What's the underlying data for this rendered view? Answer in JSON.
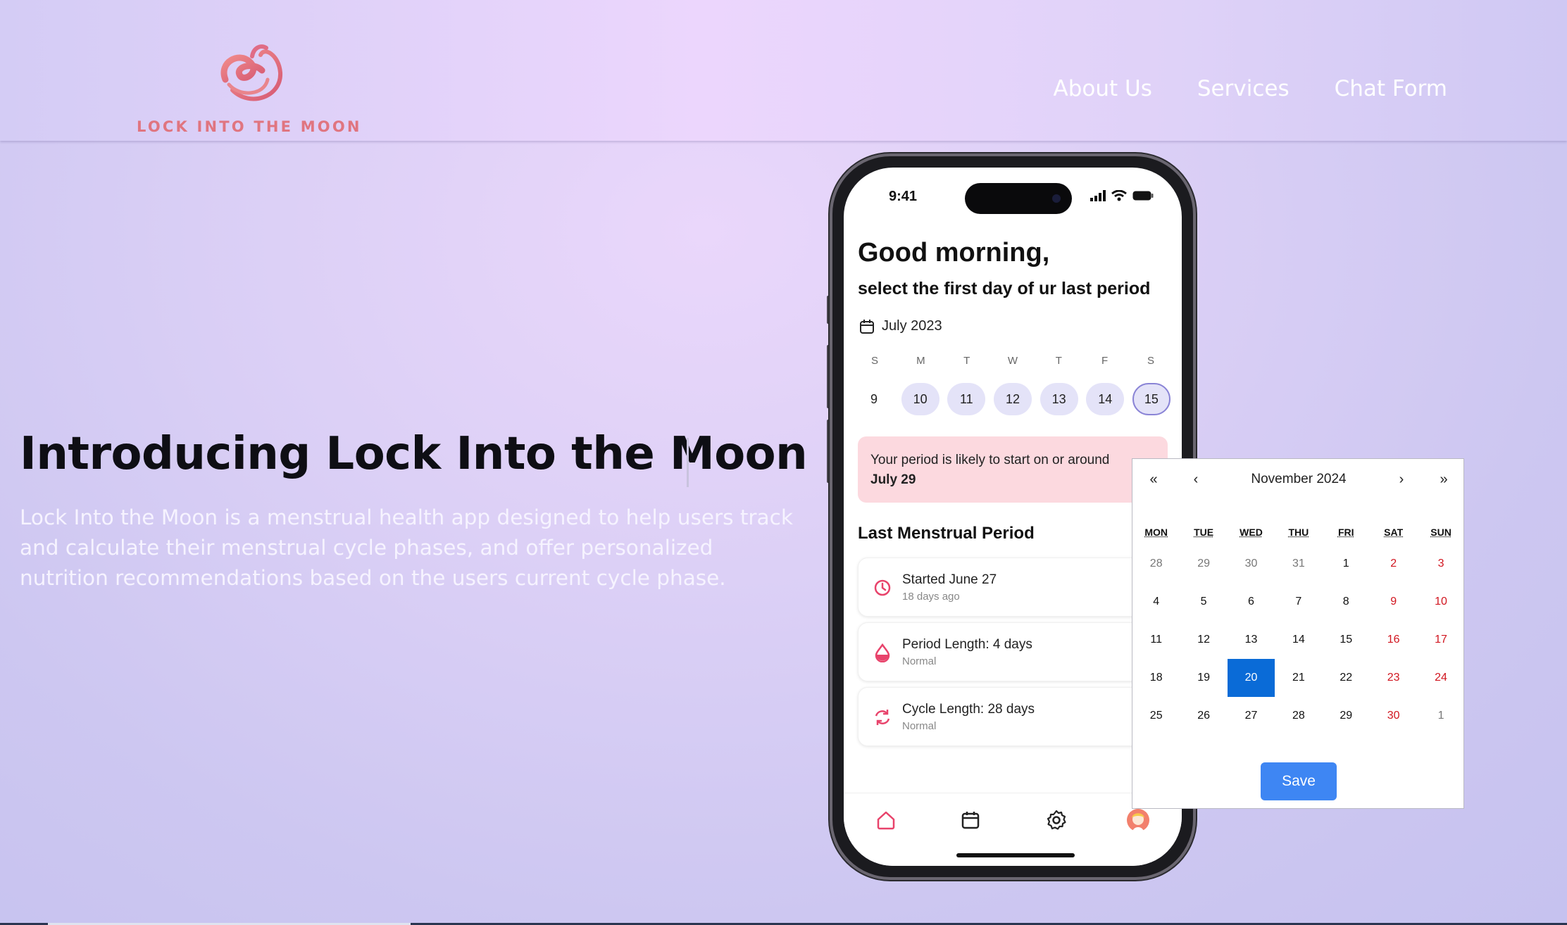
{
  "brand": {
    "name": "LOCK INTO THE MOON"
  },
  "nav": [
    {
      "label": "About Us"
    },
    {
      "label": "Services"
    },
    {
      "label": "Chat Form"
    }
  ],
  "hero": {
    "title": "Introducing Lock Into the Moon",
    "description": "Lock Into the Moon is a menstrual health app designed to help users track and calculate their menstrual cycle phases, and offer personalized nutrition recommendations based on the users current cycle phase."
  },
  "phone": {
    "time": "9:41",
    "greeting": "Good morning,",
    "subtitle": "select the first day of ur last period",
    "month": "July 2023",
    "weekdays": [
      "S",
      "M",
      "T",
      "W",
      "T",
      "F",
      "S"
    ],
    "days": [
      "9",
      "10",
      "11",
      "12",
      "13",
      "14",
      "15"
    ],
    "alert_text": "Your period is likely to start on or around",
    "alert_date": "July 29",
    "section_title": "Last Menstrual Period",
    "cards": [
      {
        "title": "Started June 27",
        "sub": "18 days ago",
        "icon": "clock-icon"
      },
      {
        "title": "Period Length: 4 days",
        "sub": "Normal",
        "icon": "drop-icon"
      },
      {
        "title": "Cycle Length: 28 days",
        "sub": "Normal",
        "icon": "cycle-icon"
      }
    ],
    "tabs": [
      "home-icon",
      "calendar-icon",
      "settings-icon",
      "avatar"
    ]
  },
  "picker": {
    "prev_year": "«",
    "prev_month": "‹",
    "next_month": "›",
    "next_year": "»",
    "title": "November 2024",
    "weekdays": [
      "MON",
      "TUE",
      "WED",
      "THU",
      "FRI",
      "SAT",
      "SUN"
    ],
    "weeks": [
      [
        "28",
        "29",
        "30",
        "31",
        "1",
        "2",
        "3"
      ],
      [
        "4",
        "5",
        "6",
        "7",
        "8",
        "9",
        "10"
      ],
      [
        "11",
        "12",
        "13",
        "14",
        "15",
        "16",
        "17"
      ],
      [
        "18",
        "19",
        "20",
        "21",
        "22",
        "23",
        "24"
      ],
      [
        "25",
        "26",
        "27",
        "28",
        "29",
        "30",
        "1"
      ]
    ],
    "selected": "20",
    "save_label": "Save"
  },
  "colors": {
    "accent_pink": "#e07580",
    "picker_selected": "#0a6bd7",
    "save_button": "#3e86f3",
    "weekend": "#d1151f"
  }
}
